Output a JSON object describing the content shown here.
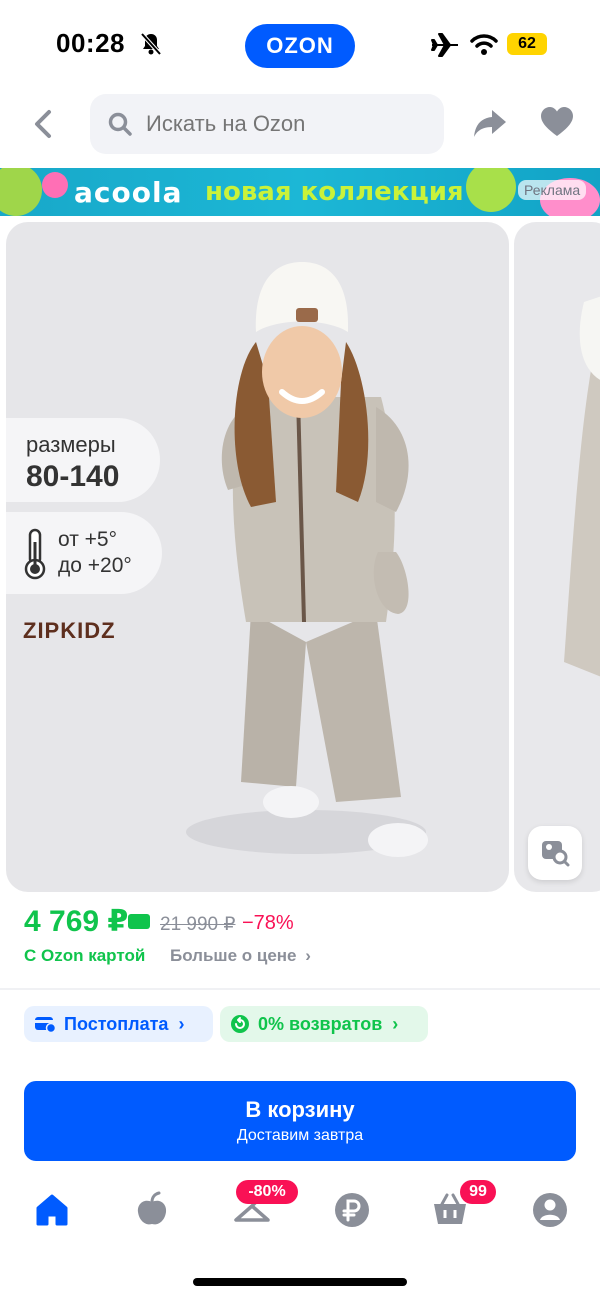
{
  "status_bar": {
    "time": "00:28",
    "app_pill": "OZON",
    "battery": "62"
  },
  "search": {
    "placeholder": "Искать на Ozon"
  },
  "ad_banner": {
    "brand": "acoola",
    "text": "новая коллекция",
    "badge": "Реклама"
  },
  "product": {
    "sizes_label": "размеры",
    "sizes_value": "80-140",
    "temp_from": "от  +5°",
    "temp_to": "до +20°",
    "brand": "ZIPKIDZ",
    "price": "4 769 ₽",
    "old_price": "21 990 ₽",
    "discount": "−78%",
    "card_note": "С Ozon картой",
    "more_price": "Больше о цене"
  },
  "chips": {
    "postpay": "Постоплата",
    "returns": "0% возвратов"
  },
  "cart_button": {
    "label": "В корзину",
    "sub": "Доставим завтра"
  },
  "tabbar": {
    "items": [
      {
        "icon": "home-icon",
        "active": true
      },
      {
        "icon": "fresh-icon",
        "active": false
      },
      {
        "icon": "sale-icon",
        "badge": "-80%",
        "active": false
      },
      {
        "icon": "ruble-icon",
        "active": false
      },
      {
        "icon": "cart-icon",
        "badge": "99",
        "active": false
      },
      {
        "icon": "profile-icon",
        "active": false
      }
    ]
  },
  "colors": {
    "primary": "#005bff",
    "green": "#10c44c",
    "pink": "#f91155",
    "gray": "#8b8f99"
  }
}
